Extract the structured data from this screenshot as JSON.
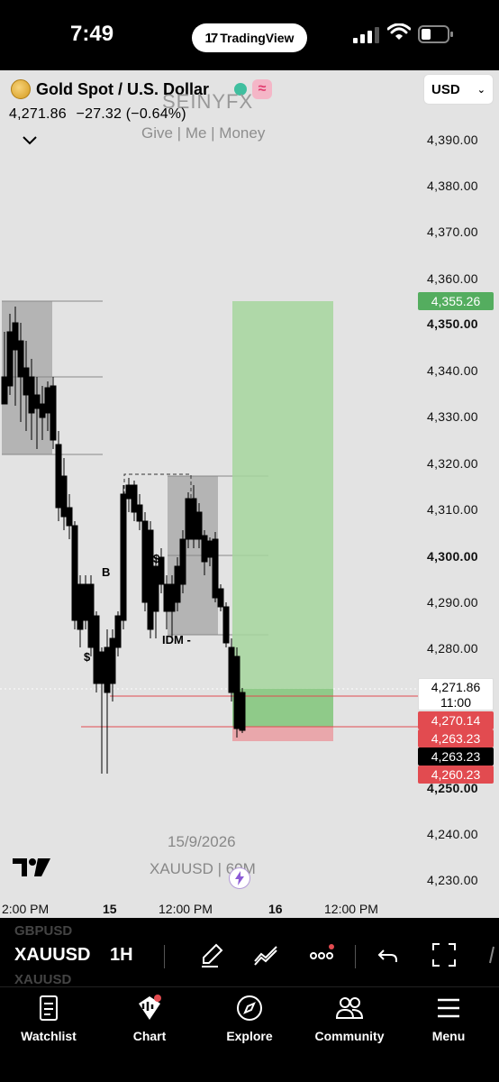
{
  "status_bar": {
    "time": "7:49",
    "pill_label": "TradingView"
  },
  "header": {
    "symbol_title": "Gold Spot / U.S. Dollar",
    "last_price": "4,271.86",
    "change": "−27.32 (−0.64%)",
    "currency": "USD",
    "watermark_title": "SEINYFX",
    "watermark_sub": "Give | Me | Money"
  },
  "price_scale": {
    "labels": [
      "4,390.00",
      "4,380.00",
      "4,370.00",
      "4,360.00",
      "4,350.00",
      "4,340.00",
      "4,330.00",
      "4,320.00",
      "4,310.00",
      "4,300.00",
      "4,290.00",
      "4,280.00",
      "4,250.00",
      "4,240.00",
      "4,230.00"
    ],
    "tags": {
      "target": "4,355.26",
      "last": "4,271.86",
      "countdown": "11:00",
      "tag1": "4,270.14",
      "tag2": "4,263.23",
      "tag3": "4,263.23",
      "tag4": "4,260.23"
    }
  },
  "chart_labels": {
    "b_label": "B",
    "dollar1": "$",
    "dollar2": "$",
    "idm": "IDM -",
    "date_watermark": "15/9/2026",
    "symbol_watermark": "XAUUSD | 60M"
  },
  "time_axis": [
    "2:00 PM",
    "15",
    "12:00 PM",
    "16",
    "12:00 PM"
  ],
  "toolbar": {
    "ghost_top": "GBPUSD",
    "ghost_bottom": "XAUUSD",
    "symbol": "XAUUSD",
    "interval": "1H"
  },
  "nav": {
    "watchlist": "Watchlist",
    "chart": "Chart",
    "explore": "Explore",
    "community": "Community",
    "menu": "Menu"
  },
  "colors": {
    "bull_zone": "#a6d69e",
    "bear_zone": "#e9a7ab",
    "zone_gray": "#a8a8a8",
    "accent_red": "#e24b50"
  }
}
